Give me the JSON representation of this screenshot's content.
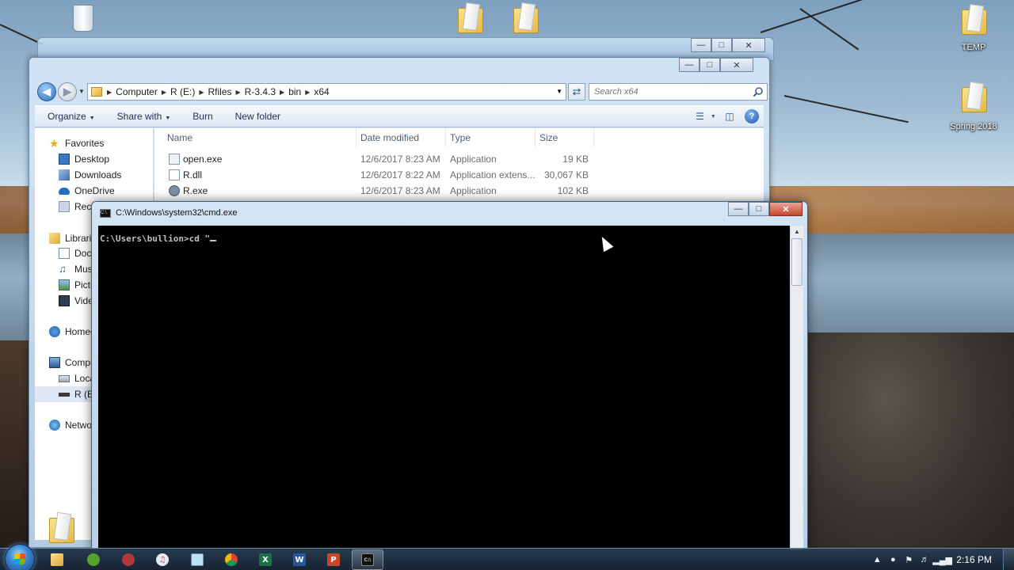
{
  "desktop": {
    "icons": [
      {
        "label": "Recycle Bin"
      },
      {
        "label": ""
      },
      {
        "label": ""
      },
      {
        "label": "TEMP"
      },
      {
        "label": "Spring 2018"
      }
    ]
  },
  "explorer": {
    "breadcrumb": [
      "Computer",
      "R (E:)",
      "Rfiles",
      "R-3.4.3",
      "bin",
      "x64"
    ],
    "search_placeholder": "Search x64",
    "toolbar": {
      "organize": "Organize",
      "share_with": "Share with",
      "burn": "Burn",
      "new_folder": "New folder"
    },
    "nav": {
      "favorites": "Favorites",
      "desktop": "Desktop",
      "downloads": "Downloads",
      "onedrive": "OneDrive",
      "recent": "Recen",
      "libraries": "Librari",
      "documents": "Docu",
      "music": "Musi",
      "pictures": "Pictu",
      "videos": "Video",
      "homegroup": "Homeg",
      "computer": "Compu",
      "local": "Loca",
      "r_drive": "R (E:)",
      "network": "Netwo"
    },
    "columns": {
      "name": "Name",
      "date": "Date modified",
      "type": "Type",
      "size": "Size"
    },
    "files": [
      {
        "name": "open.exe",
        "date": "12/6/2017 8:23 AM",
        "type": "Application",
        "size": "19 KB"
      },
      {
        "name": "R.dll",
        "date": "12/6/2017 8:22 AM",
        "type": "Application extens...",
        "size": "30,067 KB"
      },
      {
        "name": "R.exe",
        "date": "12/6/2017 8:23 AM",
        "type": "Application",
        "size": "102 KB"
      }
    ]
  },
  "cmd": {
    "title": "C:\\Windows\\system32\\cmd.exe",
    "prompt": "C:\\Users\\bullion>cd \""
  },
  "taskbar": {
    "clock": "2:16 PM"
  },
  "colors": {
    "cmd_background": "#000000",
    "cmd_text": "#c0c0c0",
    "taskbar": "#1f3348",
    "close_button": "#c7452b"
  }
}
